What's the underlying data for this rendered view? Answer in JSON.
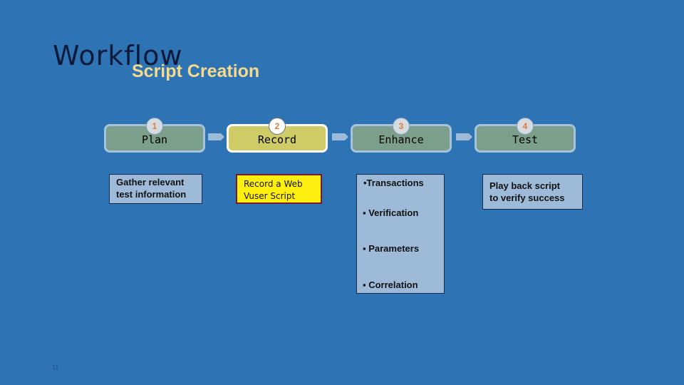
{
  "slide": {
    "title": "Workflow",
    "subtitle": "Script Creation",
    "page_number": "11"
  },
  "colors": {
    "background": "#2e74b5",
    "subtitle": "#f5d98c",
    "step_default": "#7b9f8b",
    "step_active": "#cfcc67",
    "desc_default": "#9dbbd9",
    "desc_active": "#ffef10",
    "step_number": "#e07b39"
  },
  "steps": [
    {
      "number": "1",
      "label": "Plan",
      "active": false,
      "description": [
        "Gather relevant",
        "test information"
      ]
    },
    {
      "number": "2",
      "label": "Record",
      "active": true,
      "description": [
        "Record a Web",
        "Vuser Script"
      ]
    },
    {
      "number": "3",
      "label": "Enhance",
      "active": false,
      "bullets": [
        "•Transactions",
        "▪ Verification",
        "▪ Parameters",
        "▪ Correlation"
      ]
    },
    {
      "number": "4",
      "label": "Test",
      "active": false,
      "description": [
        "Play back script",
        "to verify success"
      ]
    }
  ]
}
